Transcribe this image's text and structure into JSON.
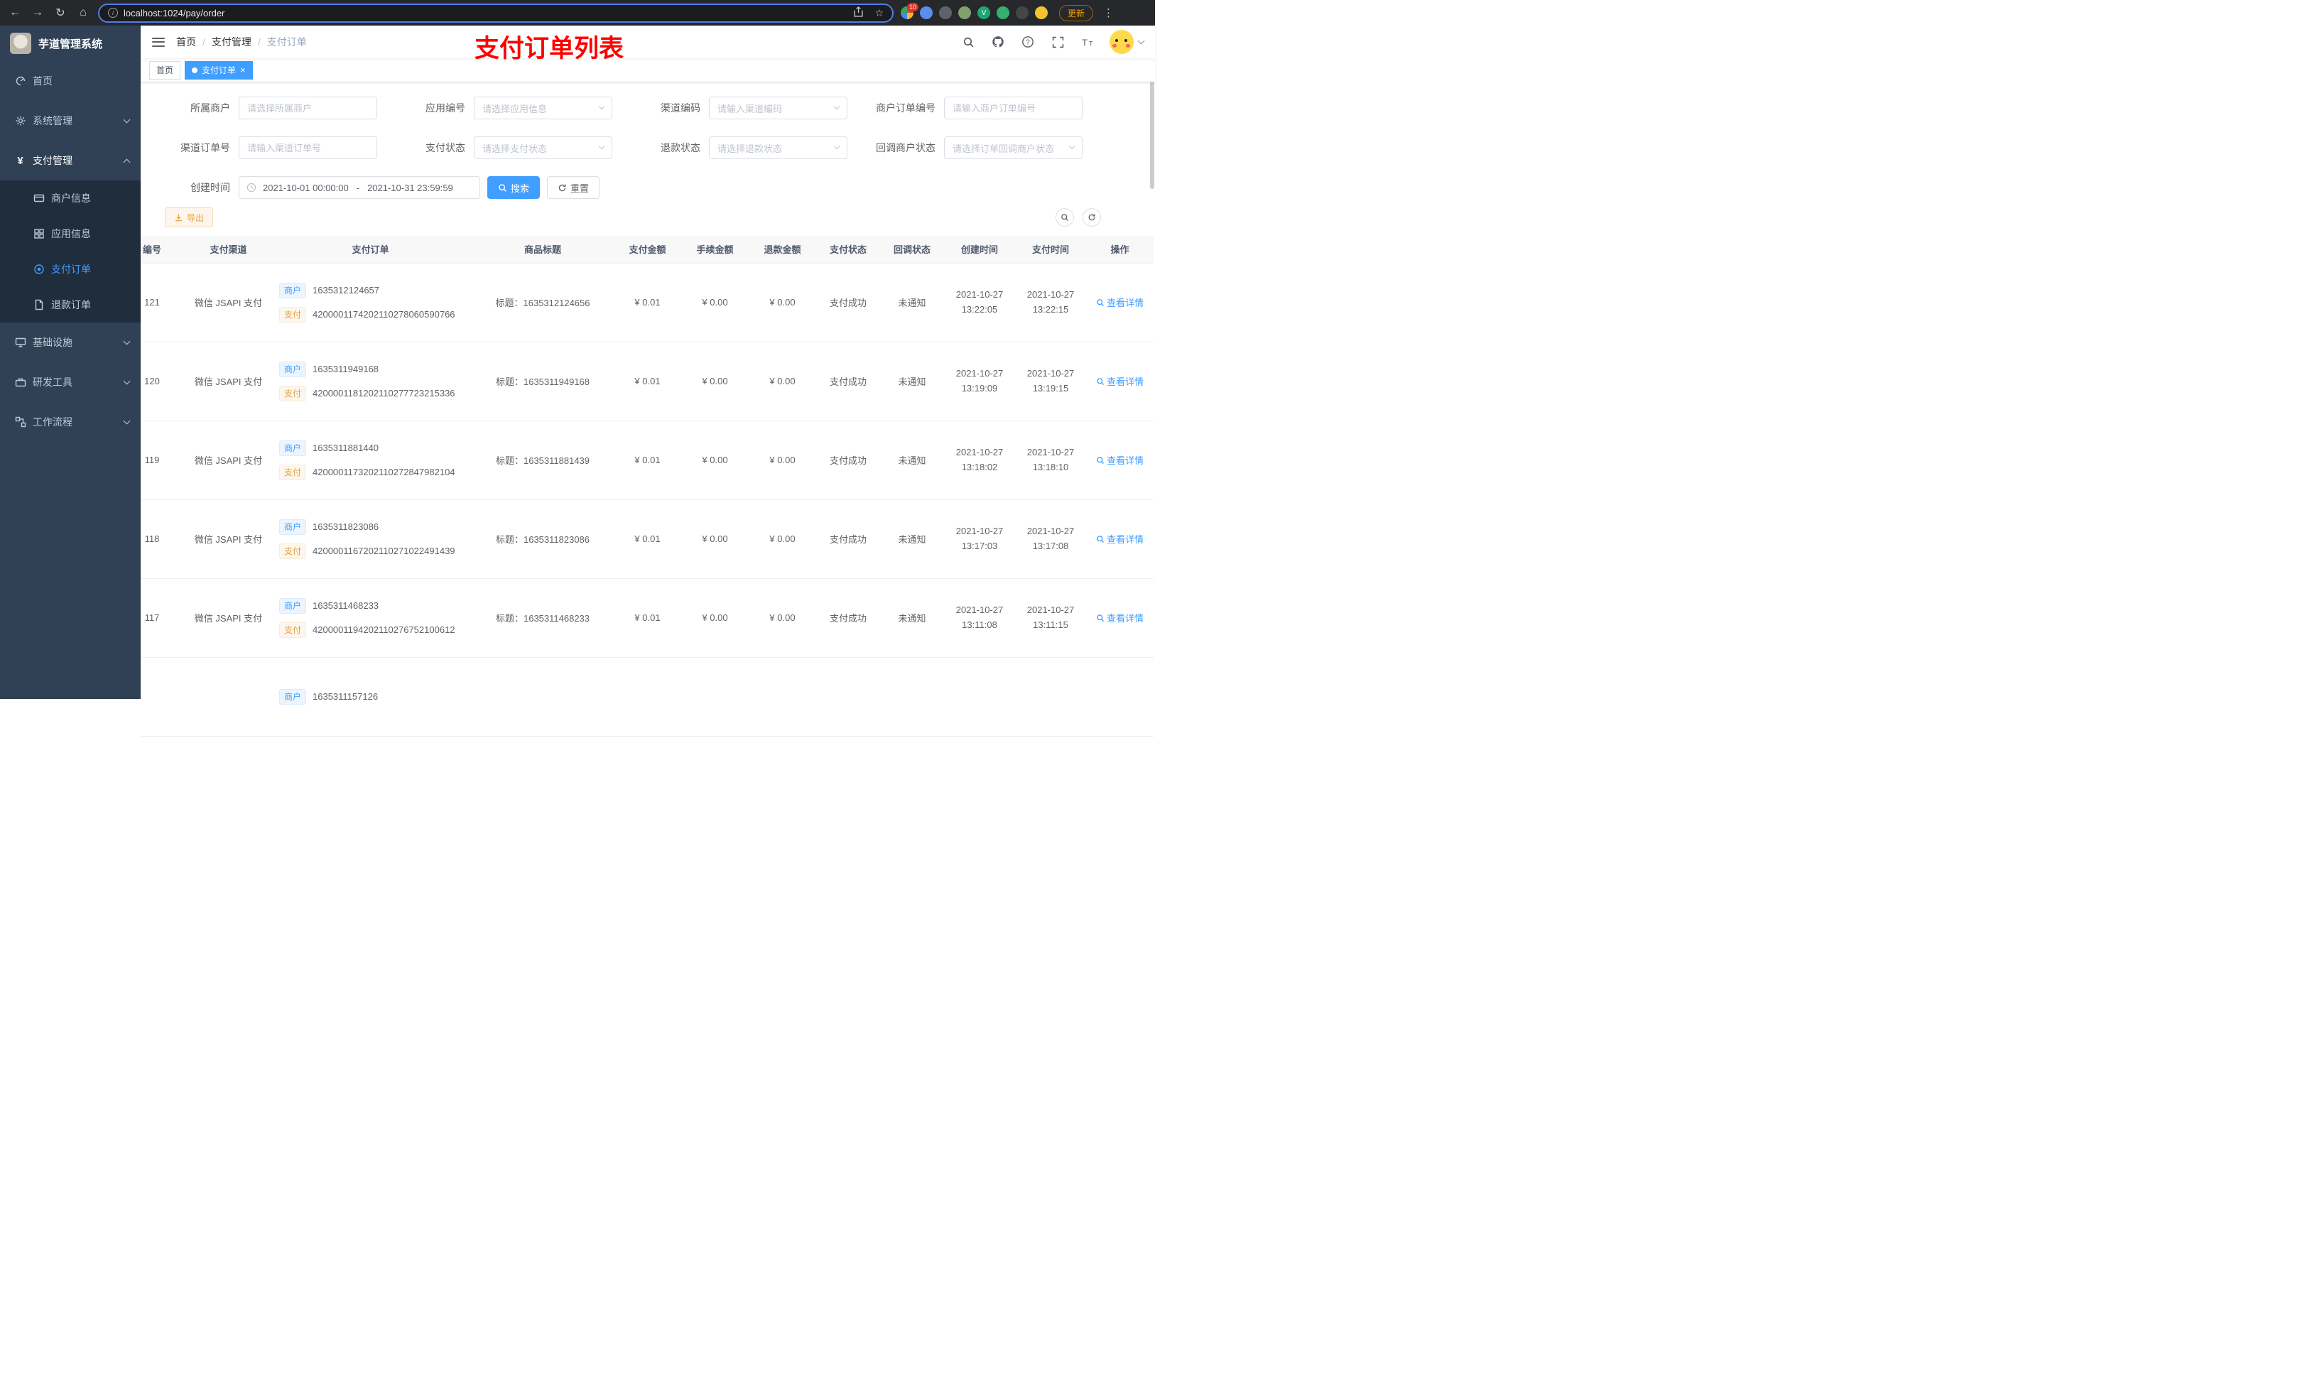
{
  "browser": {
    "url": "localhost:1024/pay/order",
    "update_label": "更新",
    "extensions": [
      {
        "name": "puzzle-extension-icon",
        "color": "multi",
        "badge": "10"
      },
      {
        "name": "drop-extension-icon",
        "color": "#5b8def"
      },
      {
        "name": "globe-extension-icon",
        "color": "#5f6368"
      },
      {
        "name": "leaf-extension-icon",
        "color": "#7fa06f"
      },
      {
        "name": "check-extension-icon",
        "color": "#1ea672",
        "glyph": "V"
      },
      {
        "name": "chat-extension-icon",
        "color": "#35b06f"
      },
      {
        "name": "pin-extension-icon",
        "color": "#444746"
      },
      {
        "name": "smiley-extension-icon",
        "color": "#f4c430"
      }
    ]
  },
  "sidebar": {
    "logo_title": "芋道管理系统",
    "items": [
      {
        "key": "home",
        "icon": "dashboard-icon",
        "label": "首页"
      },
      {
        "key": "system",
        "icon": "gear-icon",
        "label": "系统管理",
        "expandable": true
      },
      {
        "key": "payment",
        "icon": "yen-icon",
        "label": "支付管理",
        "expandable": true,
        "expanded": true,
        "children": [
          {
            "key": "merchant-info",
            "icon": "card-icon",
            "label": "商户信息"
          },
          {
            "key": "app-info",
            "icon": "grid-icon",
            "label": "应用信息"
          },
          {
            "key": "pay-order",
            "icon": "target-icon",
            "label": "支付订单",
            "active": true
          },
          {
            "key": "refund-order",
            "icon": "document-icon",
            "label": "退款订单"
          }
        ]
      },
      {
        "key": "infrastructure",
        "icon": "monitor-icon",
        "label": "基础设施",
        "expandable": true
      },
      {
        "key": "dev-tools",
        "icon": "toolbox-icon",
        "label": "研发工具",
        "expandable": true
      },
      {
        "key": "workflow",
        "icon": "workflow-icon",
        "label": "工作流程",
        "expandable": true
      }
    ]
  },
  "header": {
    "breadcrumb": [
      "首页",
      "支付管理",
      "支付订单"
    ],
    "annotation": "支付订单列表"
  },
  "tabs": [
    {
      "label": "首页",
      "active": false,
      "closable": false
    },
    {
      "label": "支付订单",
      "active": true,
      "closable": true
    }
  ],
  "filters": {
    "fields": [
      {
        "label": "所属商户",
        "placeholder": "请选择所属商户",
        "type": "input"
      },
      {
        "label": "应用编号",
        "placeholder": "请选择应用信息",
        "type": "select"
      },
      {
        "label": "渠道编码",
        "placeholder": "请输入渠道编码",
        "type": "select"
      },
      {
        "label": "商户订单编号",
        "placeholder": "请输入商户订单编号",
        "type": "input"
      },
      {
        "label": "渠道订单号",
        "placeholder": "请输入渠道订单号",
        "type": "input"
      },
      {
        "label": "支付状态",
        "placeholder": "请选择支付状态",
        "type": "select"
      },
      {
        "label": "退款状态",
        "placeholder": "请选择退款状态",
        "type": "select"
      },
      {
        "label": "回调商户状态",
        "placeholder": "请选择订单回调商户状态",
        "type": "select"
      }
    ],
    "date_label": "创建时间",
    "date_start": "2021-10-01 00:00:00",
    "date_separator": "-",
    "date_end": "2021-10-31 23:59:59",
    "search_label": "搜索",
    "reset_label": "重置"
  },
  "toolbar": {
    "export_label": "导出"
  },
  "table": {
    "columns": [
      "编号",
      "支付渠道",
      "支付订单",
      "商品标题",
      "支付金额",
      "手续金额",
      "退款金额",
      "支付状态",
      "回调状态",
      "创建时间",
      "支付时间",
      "操作"
    ],
    "merchant_tag": "商户",
    "pay_tag": "支付",
    "title_prefix": "标题：",
    "action_label": "查看详情",
    "rows": [
      {
        "id": "121",
        "channel": "微信 JSAPI 支付",
        "merchant_no": "1635312124657",
        "pay_no": "4200001174202110278060590766",
        "title": "1635312124656",
        "amount": "¥ 0.01",
        "fee": "¥ 0.00",
        "refund": "¥ 0.00",
        "status": "支付成功",
        "notify": "未通知",
        "create_time": "2021-10-27 13:22:05",
        "pay_time": "2021-10-27 13:22:15"
      },
      {
        "id": "120",
        "channel": "微信 JSAPI 支付",
        "merchant_no": "1635311949168",
        "pay_no": "4200001181202110277723215336",
        "title": "1635311949168",
        "amount": "¥ 0.01",
        "fee": "¥ 0.00",
        "refund": "¥ 0.00",
        "status": "支付成功",
        "notify": "未通知",
        "create_time": "2021-10-27 13:19:09",
        "pay_time": "2021-10-27 13:19:15"
      },
      {
        "id": "119",
        "channel": "微信 JSAPI 支付",
        "merchant_no": "1635311881440",
        "pay_no": "4200001173202110272847982104",
        "title": "1635311881439",
        "amount": "¥ 0.01",
        "fee": "¥ 0.00",
        "refund": "¥ 0.00",
        "status": "支付成功",
        "notify": "未通知",
        "create_time": "2021-10-27 13:18:02",
        "pay_time": "2021-10-27 13:18:10"
      },
      {
        "id": "118",
        "channel": "微信 JSAPI 支付",
        "merchant_no": "1635311823086",
        "pay_no": "4200001167202110271022491439",
        "title": "1635311823086",
        "amount": "¥ 0.01",
        "fee": "¥ 0.00",
        "refund": "¥ 0.00",
        "status": "支付成功",
        "notify": "未通知",
        "create_time": "2021-10-27 13:17:03",
        "pay_time": "2021-10-27 13:17:08"
      },
      {
        "id": "117",
        "channel": "微信 JSAPI 支付",
        "merchant_no": "1635311468233",
        "pay_no": "4200001194202110276752100612",
        "title": "1635311468233",
        "amount": "¥ 0.01",
        "fee": "¥ 0.00",
        "refund": "¥ 0.00",
        "status": "支付成功",
        "notify": "未通知",
        "create_time": "2021-10-27 13:11:08",
        "pay_time": "2021-10-27 13:11:15"
      },
      {
        "id": "",
        "channel": "",
        "merchant_no": "1635311157126",
        "pay_no": "",
        "title": "",
        "amount": "",
        "fee": "",
        "refund": "",
        "status": "",
        "notify": "",
        "create_time": "",
        "pay_time": ""
      }
    ]
  }
}
